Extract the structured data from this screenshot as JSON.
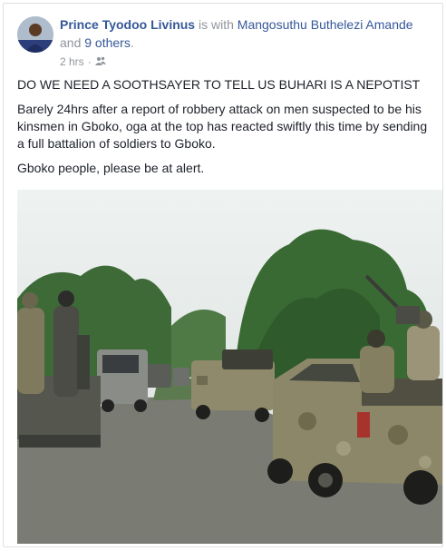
{
  "post": {
    "author": "Prince Tyodoo Livinus",
    "with_text": "is with",
    "tagged": "Mangosuthu Buthelezi Amande",
    "and_text": "and",
    "others": "9 others",
    "period": ".",
    "time": "2 hrs",
    "privacy_icon": "friends-icon",
    "paragraphs": [
      "DO WE NEED A SOOTHSAYER TO TELL US BUHARI IS A NEPOTIST",
      "Barely 24hrs after a report of robbery attack on men suspected to be his kinsmen in Gboko, oga at the top has reacted swiftly this time by sending a full battalion of soldiers to Gboko.",
      "Gboko people, please be at alert."
    ]
  },
  "colors": {
    "link": "#365899",
    "text": "#1d2129",
    "muted": "#90949c",
    "sky": "#e6ecec",
    "road": "#7d8075"
  }
}
